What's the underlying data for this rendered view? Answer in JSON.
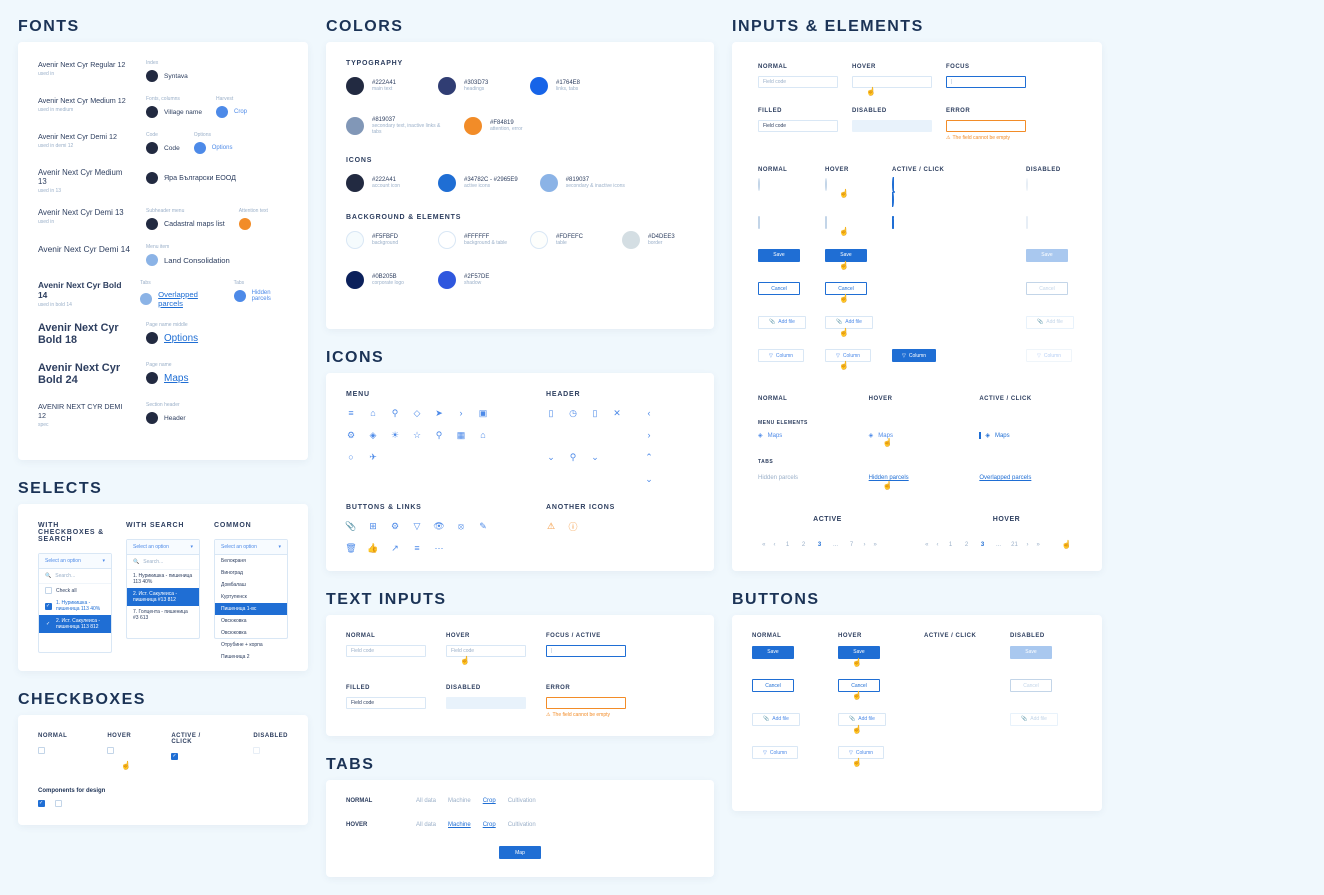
{
  "sections": {
    "fonts": "FONTS",
    "colors": "COLORS",
    "inputs": "INPUTS & ELEMENTS",
    "selects": "SELECTS",
    "checkboxes": "CHECKBOXES",
    "icons": "ICONS",
    "textinputs": "TEXT INPUTS",
    "tabs": "TABS",
    "buttons": "BUTTONS"
  },
  "fonts": {
    "rows": [
      {
        "name": "Avenir Next Cyr Regular 12",
        "sub": "used in",
        "a": "Syntava",
        "atiny": "Index"
      },
      {
        "name": "Avenir Next Cyr Medium 12",
        "sub": "used in medium",
        "a": "Village name",
        "atiny": "Fonts, columns",
        "b": "Crop",
        "btiny": "Harvest"
      },
      {
        "name": "Avenir Next Cyr Demi 12",
        "sub": "used in demi 12",
        "a": "Code",
        "atiny": "Code",
        "b": "Options",
        "btiny": "Options"
      },
      {
        "name": "Avenir Next Cyr Medium 13",
        "sub": "used in 13",
        "a": "Яра Български ЕООД",
        "atiny": ""
      },
      {
        "name": "Avenir Next Cyr Demi 13",
        "sub": "used in",
        "a": "Cadastral maps list",
        "atiny": "Subheader menu",
        "b": "",
        "btiny": "Attention text"
      },
      {
        "name": "Avenir Next Cyr Demi 14",
        "sub": "",
        "a": "Land Consolidation",
        "atiny": "Menu item"
      },
      {
        "name": "Avenir Next Cyr Bold 14",
        "sub": "used in bold 14",
        "a": "Overlapped parcels",
        "atiny": "Tabs",
        "b": "Hidden parcels",
        "btiny": "Tabs"
      },
      {
        "name": "Avenir Next Cyr Bold 18",
        "sub": "",
        "a": "Options",
        "atiny": "Page name middle"
      },
      {
        "name": "Avenir Next Cyr Bold 24",
        "sub": "",
        "a": "Maps",
        "atiny": "Page name"
      },
      {
        "name": "AVENIR NEXT CYR DEMI 12",
        "sub": "spec",
        "a": "Header",
        "atiny": "Section header"
      }
    ]
  },
  "colors": {
    "typography": "TYPOGRAPHY",
    "icons": "ICONS",
    "bg": "BACKGROUND & ELEMENTS",
    "typo_items": [
      {
        "hex": "#222A41",
        "use": "main text",
        "c": "#222a41"
      },
      {
        "hex": "#303D73",
        "use": "headings",
        "c": "#303d73"
      },
      {
        "hex": "#1764E8",
        "use": "links, tabs",
        "c": "#1764e8"
      },
      {
        "hex": "#819037",
        "use": "secondary text, inactive links & tabs",
        "c": "#8197b7"
      },
      {
        "hex": "#F84819",
        "use": "attention, error",
        "c": "#f28c28"
      }
    ],
    "icon_items": [
      {
        "hex": "#222A41",
        "use": "account icon",
        "c": "#222a41"
      },
      {
        "hex": "#34782C - #2965E9",
        "use": "active icons",
        "c": "#1f6ed4"
      },
      {
        "hex": "#819037",
        "use": "secondary & inactive icons",
        "c": "#8bb3e6"
      }
    ],
    "bg_items": [
      {
        "hex": "#F5FBFD",
        "use": "background",
        "c": "#f5fbfd",
        "ring": true
      },
      {
        "hex": "#FFFFFF",
        "use": "background & table",
        "c": "#ffffff",
        "ring": true
      },
      {
        "hex": "#FDFEFC",
        "use": "table",
        "c": "#fdfefc",
        "ring": true
      },
      {
        "hex": "#D4DEE3",
        "use": "border",
        "c": "#d4dee3"
      },
      {
        "hex": "#0B205B",
        "use": "corporate logo",
        "c": "#0b205b"
      },
      {
        "hex": "#2F57DE",
        "use": "shadow",
        "c": "#2f57de"
      }
    ]
  },
  "icons": {
    "menu": "MENU",
    "header": "HEADER",
    "buttons": "BUTTONS & LINKS",
    "another": "ANOTHER ICONS"
  },
  "selects": {
    "c1": "WITH CHECKBOXES & SEARCH",
    "c2": "WITH SEARCH",
    "c3": "COMMON",
    "placeholder": "Select an option",
    "search": "Search...",
    "checkall": "Check all",
    "opt1": "1. Нурикишка - пишеница 113 40%",
    "opt2": "2. Ист. Сакулеиса - пишеница 113 812",
    "s1": "1. Нурикишка - пишеница 113 40%",
    "s2": "2. Ист. Сакулеиса - пишеница #13 812",
    "s3": "7. Голцента - пишеница #3 613",
    "o1": "Белокраня",
    "o2": "Виноград",
    "o3": "Домбалаш",
    "o4": "Куртупенск",
    "o5": "Пишеница 1-вс",
    "o6": "Овсюковка",
    "o7": "Овсюковка",
    "o8": "Отрубине + корпа",
    "o9": "Пишеница 2"
  },
  "checkboxes": {
    "normal": "NORMAL",
    "hover": "HOVER",
    "active": "ACTIVE / CLICK",
    "disabled": "DISABLED",
    "label": "Components for design"
  },
  "ti": {
    "normal": "NORMAL",
    "hover": "HOVER",
    "focus": "FOCUS / ACTIVE",
    "filled": "FILLED",
    "disabled": "DISABLED",
    "error": "ERROR",
    "placeholder": "Field code",
    "err": "The field cannot be empty"
  },
  "tabs": {
    "normal": "NORMAL",
    "hover": "HOVER",
    "t1": "All data",
    "t2": "Machine",
    "t3": "Crop",
    "t4": "Cultivation",
    "map": "Map"
  },
  "ie": {
    "normal": "NORMAL",
    "hover": "HOVER",
    "focus": "FOCUS",
    "filled": "FILLED",
    "disabled": "DISABLED",
    "error": "ERROR",
    "active": "ACTIVE / CLICK",
    "placeholder": "Field code",
    "err": "The field cannot be empty",
    "save": "Save",
    "cancel": "Cancel",
    "addfile": "Add file",
    "column": "Column",
    "menu_elements": "MENU ELEMENTS",
    "maps": "Maps",
    "tabs_lbl": "TABS",
    "hidden": "Hidden parcels",
    "overlapped": "Overlapped parcels",
    "active_lbl": "ACTIVE",
    "hover_lbl": "HOVER",
    "pages": [
      "1",
      "2",
      "3",
      "...",
      "7"
    ],
    "pages2": [
      "1",
      "2",
      "3",
      "...",
      "21"
    ]
  },
  "buttons": {
    "normal": "NORMAL",
    "hover": "HOVER",
    "active": "ACTIVE / CLICK",
    "disabled": "DISABLED",
    "save": "Save",
    "cancel": "Cancel",
    "addfile": "Add file",
    "column": "Column"
  }
}
